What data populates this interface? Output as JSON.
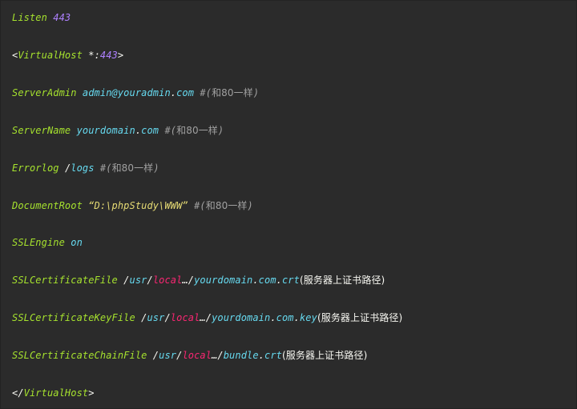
{
  "lines": {
    "listen": {
      "directive": "Listen",
      "port": "443"
    },
    "vhost_open": {
      "open": "<",
      "tag": "VirtualHost",
      "host": "*",
      "colon": ":",
      "port": "443",
      "close": ">"
    },
    "server_admin": {
      "directive": "ServerAdmin",
      "value": "admin@youradmin",
      "dot": ".",
      "tld": "com",
      "comment_hash": "#(",
      "comment_text": "和80一样",
      "comment_close": ")"
    },
    "server_name": {
      "directive": "ServerName",
      "value": "yourdomain",
      "dot": ".",
      "tld": "com",
      "comment_hash": "#(",
      "comment_text": "和80一样",
      "comment_close": ")"
    },
    "errorlog": {
      "directive": "Errorlog",
      "slash": "/",
      "value": "logs",
      "comment_hash": "#(",
      "comment_text": "和80一样",
      "comment_close": ")"
    },
    "document_root": {
      "directive": "DocumentRoot",
      "value": "“D:\\phpStudy\\WWW”",
      "comment_hash": "#(",
      "comment_text": "和80一样",
      "comment_close": ")"
    },
    "ssl_engine": {
      "directive": "SSLEngine",
      "value": "on"
    },
    "ssl_cert_file": {
      "directive": "SSLCertificateFile",
      "p1": "/",
      "usr": "usr",
      "p2": "/",
      "local": "local",
      "p3": "…/",
      "name": "yourdomain",
      "p4": ".",
      "mid": "com",
      "p5": ".",
      "ext": "crt",
      "note": "(服务器上证书路径)"
    },
    "ssl_cert_key_file": {
      "directive": "SSLCertificateKeyFile",
      "p1": "/",
      "usr": "usr",
      "p2": "/",
      "local": "local",
      "p3": "…/",
      "name": "yourdomain",
      "p4": ".",
      "mid": "com",
      "p5": ".",
      "ext": "key",
      "note": "(服务器上证书路径)"
    },
    "ssl_cert_chain_file": {
      "directive": "SSLCertificateChainFile",
      "p1": "/",
      "usr": "usr",
      "p2": "/",
      "local": "local",
      "p3": "…/",
      "name": "bundle",
      "p4": ".",
      "ext": "crt",
      "note": "(服务器上证书路径)"
    },
    "vhost_close": {
      "open": "</",
      "tag": "VirtualHost",
      "close": ">"
    }
  },
  "colors": {
    "background": "#2b2b2b",
    "directive": "#a6e22e",
    "number": "#ae81ff",
    "value": "#66d9ef",
    "text": "#f8f8f2",
    "comment": "#a0a0a0",
    "string": "#e6db74",
    "highlight": "#f92672"
  }
}
